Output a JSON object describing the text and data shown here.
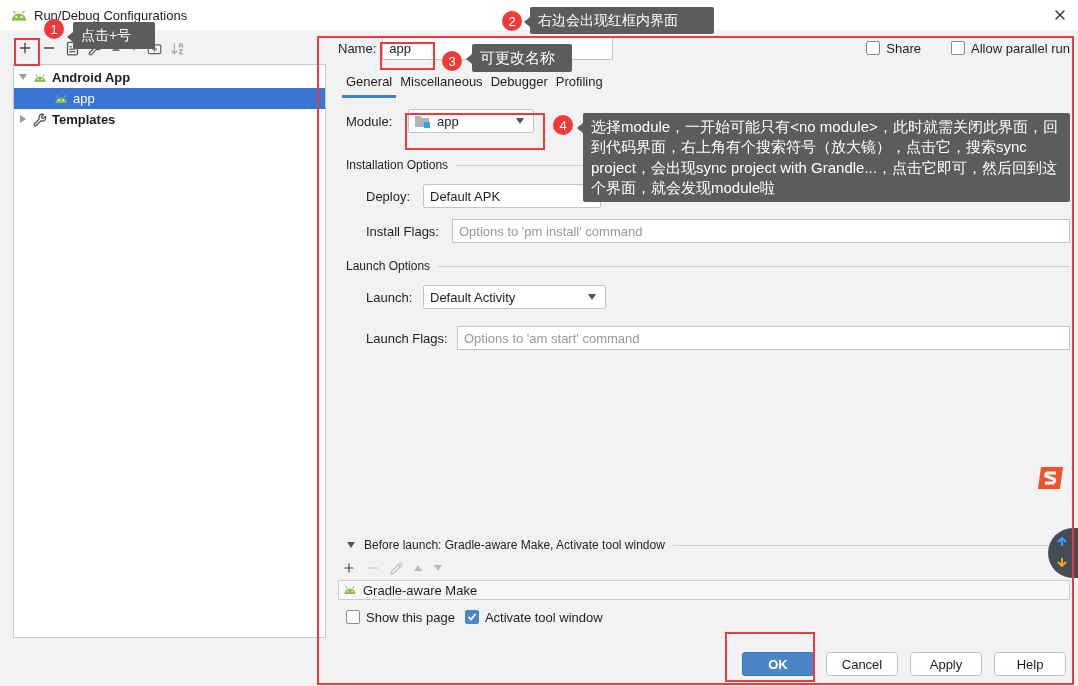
{
  "window": {
    "title": "Run/Debug Configurations"
  },
  "tree": [
    {
      "label": "Android App",
      "kind": "android",
      "expanded": true,
      "selected": false,
      "children": [
        {
          "label": "app",
          "kind": "android",
          "selected": true
        }
      ]
    },
    {
      "label": "Templates",
      "kind": "wrench",
      "expanded": false,
      "selected": false
    }
  ],
  "name_field": {
    "label": "Name:",
    "value": "app"
  },
  "options": [
    {
      "label": "Share",
      "checked": false
    },
    {
      "label": "Allow parallel run",
      "checked": false
    }
  ],
  "tabs": [
    {
      "label": "General",
      "selected": true
    },
    {
      "label": "Miscellaneous",
      "selected": false
    },
    {
      "label": "Debugger",
      "selected": false
    },
    {
      "label": "Profiling",
      "selected": false
    }
  ],
  "module": {
    "label": "Module:",
    "value": "app"
  },
  "installation": {
    "title": "Installation Options",
    "deploy_label": "Deploy:",
    "deploy_value": "Default APK",
    "flags_label": "Install Flags:",
    "flags_placeholder": "Options to 'pm install' command"
  },
  "launch": {
    "title": "Launch Options",
    "launch_label": "Launch:",
    "launch_value": "Default Activity",
    "flags_label": "Launch Flags:",
    "flags_placeholder": "Options to 'am start' command"
  },
  "before_launch": {
    "title": "Before launch: Gradle-aware Make, Activate tool window",
    "expanded": true,
    "tasks": [
      "Gradle-aware Make"
    ]
  },
  "launch_options": [
    {
      "label": "Show this page",
      "checked": false
    },
    {
      "label": "Activate tool window",
      "checked": true
    }
  ],
  "buttons": [
    {
      "label": "OK",
      "kind": "primary"
    },
    {
      "label": "Cancel",
      "kind": "normal"
    },
    {
      "label": "Apply",
      "kind": "normal"
    },
    {
      "label": "Help",
      "kind": "normal"
    }
  ],
  "annotations": [
    {
      "number": "1",
      "text": "点击+号"
    },
    {
      "number": "2",
      "text": "右边会出现红框内界面"
    },
    {
      "number": "3",
      "text": "可更改名称"
    },
    {
      "number": "4",
      "text": "选择module，一开始可能只有<no module>，此时就需关闭此界面，回到代码界面，右上角有个搜索符号（放大镜），点击它，搜索sync project，会出现sync project with Grandle...，点击它即可，然后回到这个界面，就会发现module啦"
    }
  ]
}
